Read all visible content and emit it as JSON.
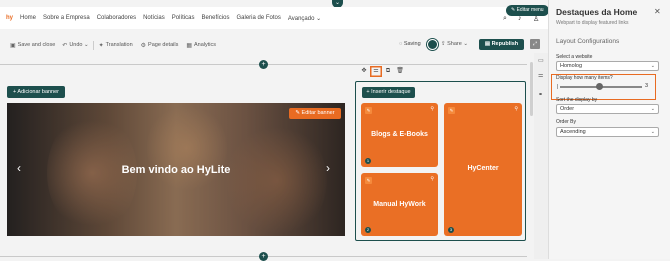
{
  "nav": {
    "logo": "hy",
    "items": [
      "Home",
      "Sobre a Empresa",
      "Colaboradores",
      "Notícias",
      "Políticas",
      "Benefícios",
      "Galeria de Fotos",
      "Avançado"
    ],
    "edit_menu": "Editar menu"
  },
  "toolbar": {
    "save_close": "Save and close",
    "undo": "Undo",
    "translation": "Translation",
    "page_details": "Page details",
    "analytics": "Analytics",
    "saving": "Saving",
    "share": "Share",
    "republish": "Republish"
  },
  "banner": {
    "add_label": "Adicionar banner",
    "edit_label": "Editar banner",
    "title": "Bem vindo ao HyLite"
  },
  "featured": {
    "insert_label": "Inserir destaque",
    "cards": [
      {
        "title": "Blogs & E-Books",
        "num": "1"
      },
      {
        "title": "HyCenter",
        "num": "3"
      },
      {
        "title": "Manual HyWork",
        "num": "2"
      }
    ]
  },
  "panel": {
    "title": "Destaques da Home",
    "subtitle": "Webpart to display featured links",
    "section": "Layout Configurations",
    "website_label": "Select a website",
    "website_value": "Homolog",
    "items_label": "Display how many items?",
    "items_value": "3",
    "sort_label": "Sort the display by",
    "sort_value": "Order",
    "order_label": "Order By",
    "order_value": "Ascending"
  },
  "colors": {
    "brand_dark": "#1d4f4d",
    "accent_orange": "#e86b22"
  }
}
